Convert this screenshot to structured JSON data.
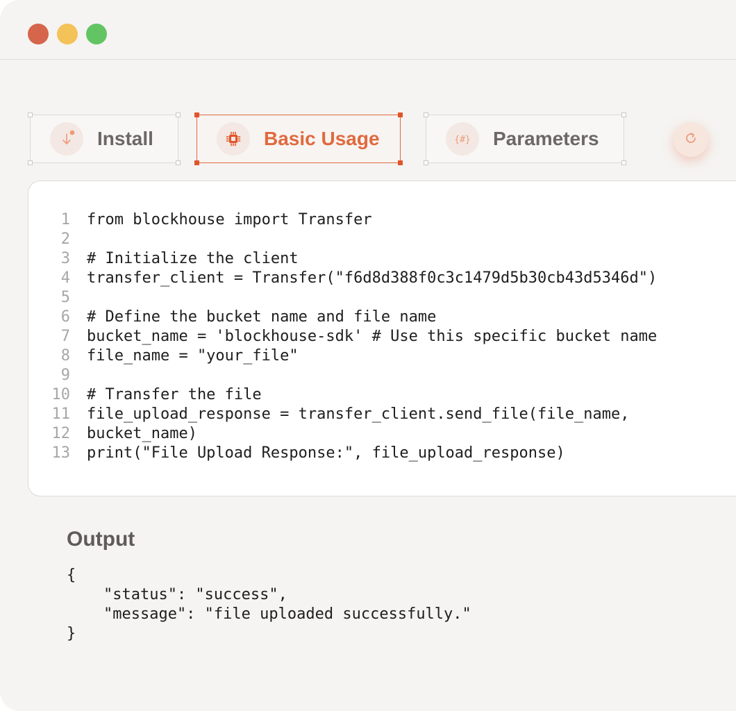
{
  "window": {
    "controls": [
      "close",
      "minimize",
      "maximize"
    ]
  },
  "tabs": [
    {
      "label": "Install",
      "icon": "download-arrow-icon",
      "active": false
    },
    {
      "label": "Basic Usage",
      "icon": "chip-icon",
      "active": true
    },
    {
      "label": "Parameters",
      "icon": "braces-hash-icon",
      "active": false
    }
  ],
  "refresh": {
    "icon": "refresh-icon"
  },
  "code": {
    "lines": [
      {
        "n": "1",
        "text": "from blockhouse import Transfer"
      },
      {
        "n": "2",
        "text": ""
      },
      {
        "n": "3",
        "text": "# Initialize the client"
      },
      {
        "n": "4",
        "text": "transfer_client = Transfer(\"f6d8d388f0c3c1479d5b30cb43d5346d\")"
      },
      {
        "n": "5",
        "text": ""
      },
      {
        "n": "6",
        "text": "# Define the bucket name and file name"
      },
      {
        "n": "7",
        "text": "bucket_name = 'blockhouse-sdk' # Use this specific bucket name"
      },
      {
        "n": "8",
        "text": "file_name = \"your_file\""
      },
      {
        "n": "9",
        "text": ""
      },
      {
        "n": "10",
        "text": "# Transfer the file"
      },
      {
        "n": "11",
        "text": "file_upload_response = transfer_client.send_file(file_name,"
      },
      {
        "n": "12",
        "text": "bucket_name)"
      },
      {
        "n": "13",
        "text": "print(\"File Upload Response:\", file_upload_response)"
      }
    ]
  },
  "output": {
    "title": "Output",
    "lines": [
      "{",
      "    \"status\": \"success\",",
      "    \"message\": \"file uploaded successfully.\"",
      "}"
    ]
  },
  "colors": {
    "accent": "#e06a3f",
    "background": "#f5f4f2",
    "close": "#d5654b",
    "minimize": "#f3c259",
    "maximize": "#62c463"
  }
}
